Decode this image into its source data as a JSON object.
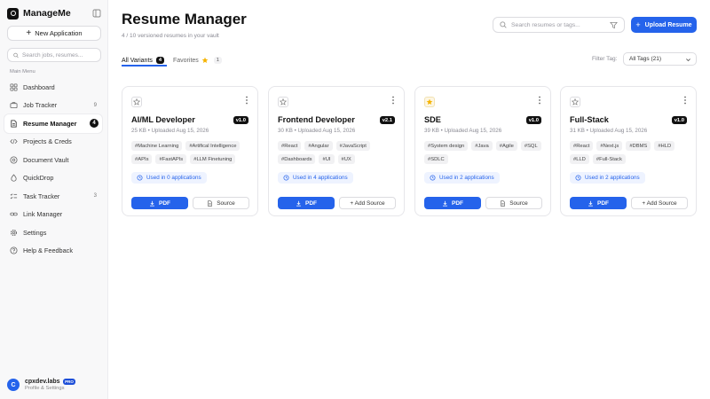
{
  "app": {
    "name": "ManageMe",
    "new_application_label": "New Application",
    "search_placeholder": "Search jobs, resumes...",
    "section_label": "Main Menu"
  },
  "sidebar": {
    "items": [
      {
        "label": "Dashboard",
        "icon": "dashboard-icon",
        "count": ""
      },
      {
        "label": "Job Tracker",
        "icon": "briefcase-icon",
        "count": "9"
      },
      {
        "label": "Resume Manager",
        "icon": "file-icon",
        "count": "4",
        "active": true
      },
      {
        "label": "Projects & Creds",
        "icon": "code-icon",
        "count": ""
      },
      {
        "label": "Document Vault",
        "icon": "vault-icon",
        "count": ""
      },
      {
        "label": "QuickDrop",
        "icon": "drop-icon",
        "count": ""
      },
      {
        "label": "Task Tracker",
        "icon": "checklist-icon",
        "count": "3"
      },
      {
        "label": "Link Manager",
        "icon": "link-icon",
        "count": ""
      },
      {
        "label": "Settings",
        "icon": "gear-icon",
        "count": ""
      },
      {
        "label": "Help & Feedback",
        "icon": "help-icon",
        "count": ""
      }
    ]
  },
  "profile": {
    "initial": "C",
    "name": "cpxdev.labs",
    "badge": "PRO",
    "sub": "Profile & Settings"
  },
  "header": {
    "title": "Resume Manager",
    "subtitle": "4 / 10 versioned resumes in your vault",
    "search_placeholder": "Search resumes or tags...",
    "upload_label": "Upload Resume"
  },
  "tabs": {
    "all_label": "All Variants",
    "all_count": "4",
    "fav_label": "Favorites",
    "fav_count": "1"
  },
  "filter": {
    "label": "Filter Tag:",
    "value": "All Tags (21)"
  },
  "colors": {
    "accent": "#2563eb",
    "favorite_star": "#f5b301"
  },
  "cards": [
    {
      "title": "AI/ML Developer",
      "version": "v1.0",
      "meta": "25 KB • Uploaded Aug 15, 2026",
      "favorite": false,
      "tags": [
        "#Machine Learning",
        "#Artifical Intelligence",
        "#APIs",
        "#FastAPIs",
        "#LLM Finetuning"
      ],
      "usage": "Used in 0 applications",
      "pdf_label": "PDF",
      "source_label": "Source"
    },
    {
      "title": "Frontend Developer",
      "version": "v2.1",
      "meta": "30 KB • Uploaded Aug 15, 2026",
      "favorite": false,
      "tags": [
        "#React",
        "#Angular",
        "#JavaScript",
        "#Dashboards",
        "#UI",
        "#UX"
      ],
      "usage": "Used in 4 applications",
      "pdf_label": "PDF",
      "source_label": "+ Add Source"
    },
    {
      "title": "SDE",
      "version": "v1.0",
      "meta": "39 KB • Uploaded Aug 15, 2026",
      "favorite": true,
      "tags": [
        "#System design",
        "#Java",
        "#Agile",
        "#SQL",
        "#SDLC"
      ],
      "usage": "Used in 2 applications",
      "pdf_label": "PDF",
      "source_label": "Source"
    },
    {
      "title": "Full-Stack",
      "version": "v1.0",
      "meta": "31 KB • Uploaded Aug 15, 2026",
      "favorite": false,
      "tags": [
        "#React",
        "#Next.js",
        "#DBMS",
        "#HLD",
        "#LLD",
        "#Full-Stack"
      ],
      "usage": "Used in 2 applications",
      "pdf_label": "PDF",
      "source_label": "+ Add Source"
    }
  ]
}
